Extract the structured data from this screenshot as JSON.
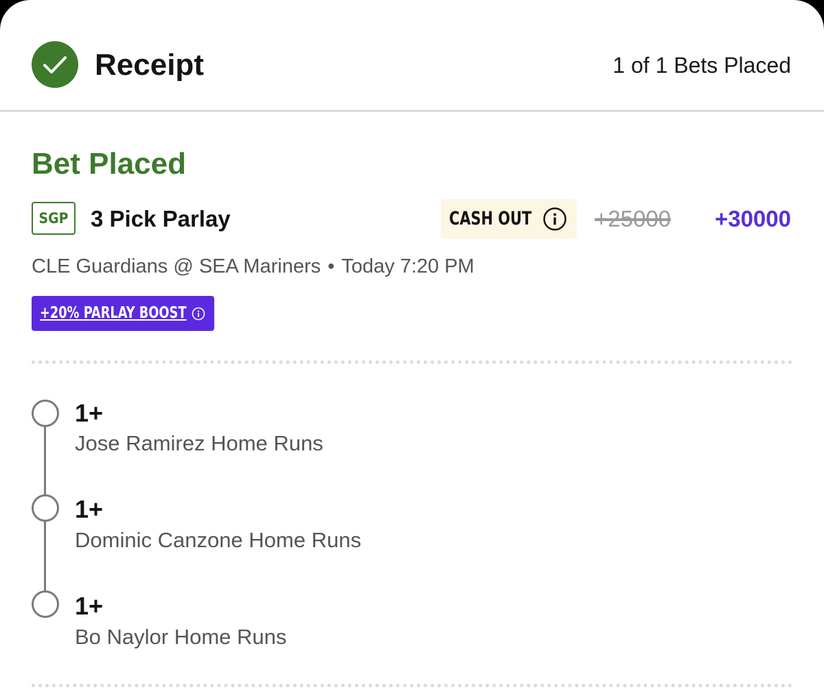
{
  "header": {
    "title": "Receipt",
    "bets_count": "1 of 1 Bets Placed",
    "icon": "check-circle-icon"
  },
  "bet": {
    "status": "Bet Placed",
    "badge": "SGP",
    "title": "3 Pick Parlay",
    "cashout_label": "CASH OUT",
    "odds_original": "+25000",
    "odds_boosted": "+30000",
    "matchup": "CLE Guardians @ SEA Mariners",
    "separator": "•",
    "time": "Today 7:20 PM",
    "boost_label": "+20% PARLAY BOOST"
  },
  "legs": [
    {
      "value": "1+",
      "description": "Jose Ramirez Home Runs"
    },
    {
      "value": "1+",
      "description": "Dominic Canzone Home Runs"
    },
    {
      "value": "1+",
      "description": "Bo Naylor Home Runs"
    }
  ],
  "colors": {
    "success_green": "#3d7a2c",
    "boost_purple": "#5b2ae0",
    "odds_purple": "#5a2fd6",
    "cashout_bg": "#fdf6e3"
  }
}
